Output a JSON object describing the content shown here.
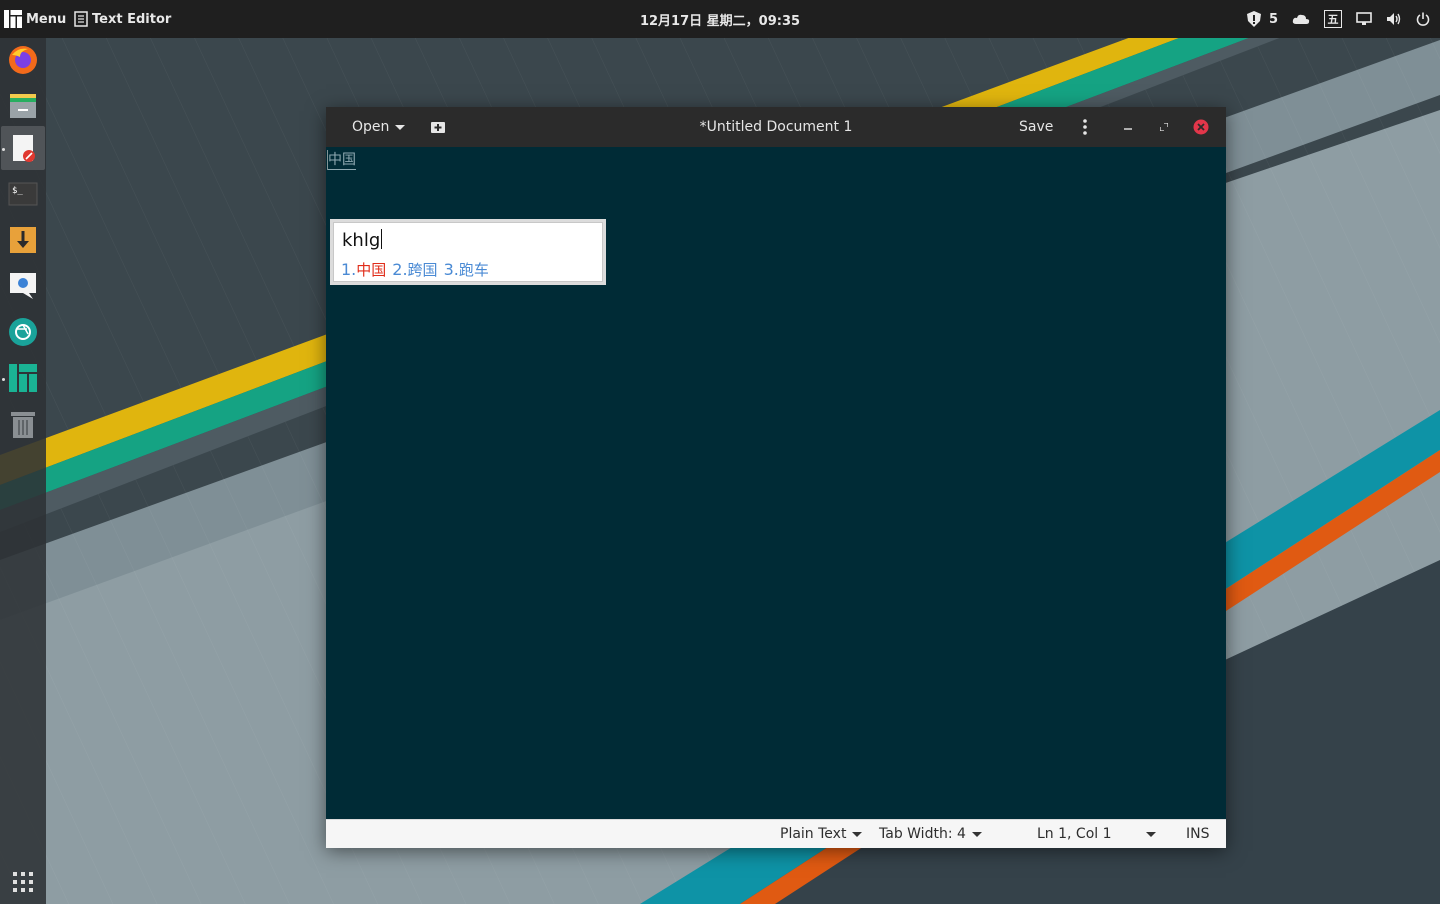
{
  "panel": {
    "menu_label": "Menu",
    "active_app": "Text Editor",
    "clock": "12月17日 星期二，09:35",
    "notification_count": "5",
    "ime_indicator": "五"
  },
  "dock": {
    "items": [
      "Firefox",
      "Files",
      "Text Editor",
      "Terminal",
      "Software Installer",
      "Chat",
      "Screenshot",
      "Manjaro Settings",
      "Trash"
    ]
  },
  "window": {
    "title": "*Untitled Document 1",
    "open_label": "Open",
    "save_label": "Save"
  },
  "editor": {
    "preedit_text": "中国"
  },
  "ime": {
    "input": "khlg",
    "candidates": [
      {
        "num": "1.",
        "text": "中国"
      },
      {
        "num": "2.",
        "text": "跨国"
      },
      {
        "num": "3.",
        "text": "跑车"
      }
    ],
    "selected_index": 0
  },
  "statusbar": {
    "language": "Plain Text",
    "tab_width": "Tab Width: 4",
    "position": "Ln 1, Col 1",
    "mode": "INS"
  },
  "colors": {
    "editor_bg": "#002b36",
    "selected_candidate": "#e02d1a",
    "candidate": "#4a8ad4",
    "stripe_yellow": "#e0b50e",
    "stripe_green": "#15a383",
    "stripe_cyan": "#0e93a6",
    "stripe_orange": "#e05a12"
  }
}
